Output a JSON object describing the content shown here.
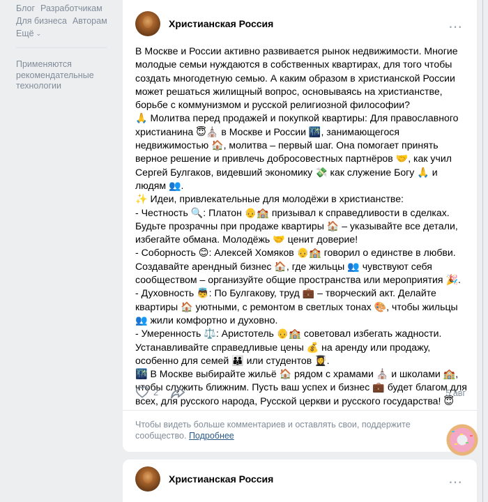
{
  "sidebar": {
    "links_row1": [
      "Блог",
      "Разработчикам"
    ],
    "links_row2": [
      "Для бизнеса",
      "Авторам"
    ],
    "more_label": "Ещё",
    "notice": "Применяются рекомендательные технологии"
  },
  "post": {
    "author": "Христианская Россия",
    "more_icon": "⋯",
    "text": "В Москве и России активно развивается рынок недвижимости. Многие молодые семьи нуждаются в собственных квартирах, для того чтобы создать многодетную семью. А каким образом в христианской России может решаться жилищный вопрос, основываясь на христианстве, борьбе с коммунизмом и русской религиозной философии?\n🙏 Молитва перед продажей и покупкой квартиры: Для православного христианина 😇⛪ в Москве и России 🌃, занимающегося недвижимостью 🏠, молитва – первый шаг. Она помогает принять верное решение и привлечь добросовестных партнёров 🤝, как учил Сергей Булгаков, видевший экономику 💸 как служение Богу 🙏 и людям 👥.\n✨ Идеи, привлекательные для молодёжи в христианстве:\n- Честность 🔍: Платон 👴🏫 призывал к справедливости в сделках. Будьте прозрачны при продаже квартиры 🏠 – указывайте все детали, избегайте обмана. Молодёжь 🤝 ценит доверие!\n- Соборность 😊: Алексей Хомяков 👴🏫 говорил о единстве в любви. Создавайте арендный бизнес 🏠, где жильцы 👥 чувствуют себя сообществом – организуйте общие пространства или мероприятия 🎉.\n- Духовность 👼: По Булгакову, труд 💼 – творческий акт. Делайте квартиры 🏠 уютными, с ремонтом в светлых тонах 🎨, чтобы жильцы 👥 жили комфортно и духовно.\n- Умеренность ⚖️: Аристотель 👴🏫 советовал избегать жадности. Устанавливайте справедливые цены 💰 на аренду или продажу, особенно для семей 👪 или студентов 👩‍🎓.\n🌃 В Москве выбирайте жильё 🏠 рядом с храмами ⛪ и школами 🏫, чтобы служить ближним. Пусть ваш успех и бизнес 💼 будет благом для всех, для русского народа, Русской церкви и русского государства! 😇",
    "likes": "2",
    "date": "5 авг",
    "comments_note": "Чтобы видеть больше комментариев и оставлять свои, поддержите сообщество.",
    "comments_link": "Подробнее"
  },
  "next_post": {
    "author": "Христианская Россия",
    "more_icon": "⋯"
  },
  "colors": {
    "background": "#edeef0",
    "card": "#ffffff",
    "muted": "#818c99",
    "link": "#2a5885"
  }
}
